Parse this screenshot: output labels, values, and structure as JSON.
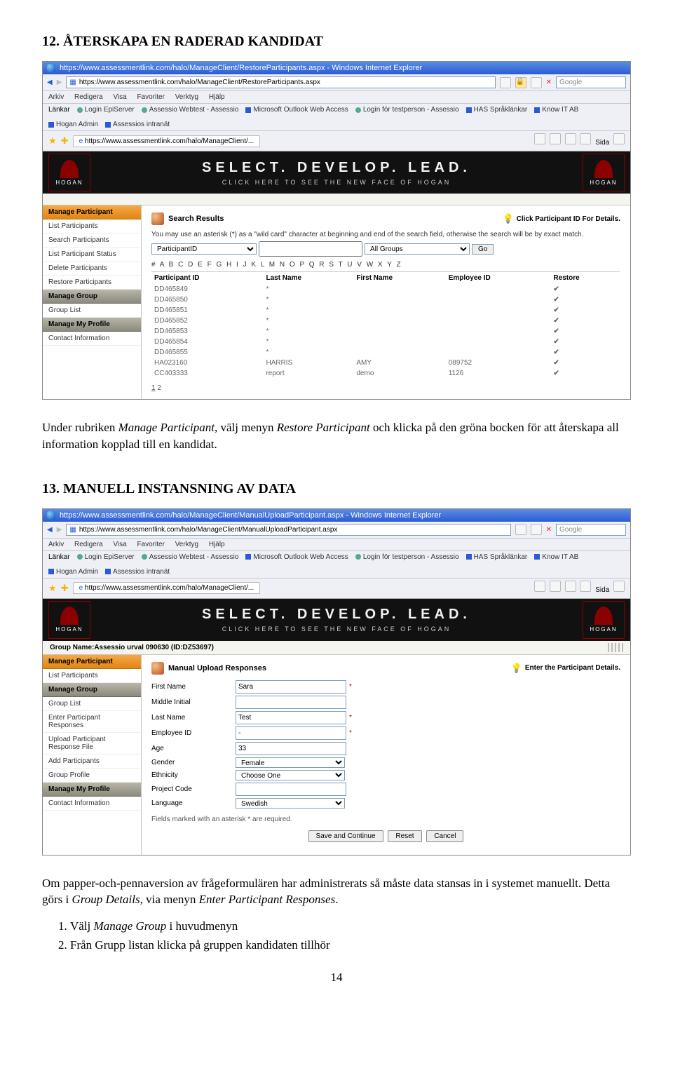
{
  "section12": {
    "heading": "12. ÅTERSKAPA EN RADERAD KANDIDAT",
    "para_pre": "Under rubriken ",
    "para_em1": "Manage Participant",
    "para_mid1": ", välj menyn ",
    "para_em2": "Restore Participant",
    "para_mid2": " och klicka på den gröna bocken för att återskapa all information kopplad till en kandidat."
  },
  "section13": {
    "heading": "13. MANUELL INSTANSNING AV DATA",
    "para_pre": "Om papper-och-pennaversion av frågeformulären har administrerats så måste data stansas in i systemet manuellt. Detta görs i ",
    "para_em1": "Group Details",
    "para_mid1": ", via menyn ",
    "para_em2": "Enter Participant Responses",
    "para_end": ".",
    "ol1_pre": "Välj ",
    "ol1_em": "Manage Group",
    "ol1_post": " i huvudmenyn",
    "ol2": "Från Grupp listan klicka på gruppen kandidaten tillhör"
  },
  "shot1": {
    "title": "https://www.assessmentlink.com/halo/ManageClient/RestoreParticipants.aspx - Windows Internet Explorer",
    "url": "https://www.assessmentlink.com/halo/ManageClient/RestoreParticipants.aspx",
    "search_ph": "Google",
    "menus": [
      "Arkiv",
      "Redigera",
      "Visa",
      "Favoriter",
      "Verktyg",
      "Hjälp"
    ],
    "links_label": "Länkar",
    "links": [
      "Login EpiServer",
      "Assessio Webtest - Assessio",
      "Microsoft Outlook Web Access",
      "Login för testperson - Assessio",
      "HAS Språklänkar",
      "Know IT AB",
      "Hogan Admin",
      "Assessios intranät"
    ],
    "tab": "https://www.assessmentlink.com/halo/ManageClient/...",
    "sida": "Sida",
    "banner_t": "SELECT. DEVELOP. LEAD.",
    "banner_s": "CLICK HERE TO SEE THE NEW FACE OF HOGAN",
    "logo": "HOGAN",
    "side_hd1": "Manage Participant",
    "side_items1": [
      "List Participants",
      "Search Participants",
      "List Participant Status",
      "Delete Participants",
      "Restore Participants"
    ],
    "side_hd2": "Manage Group",
    "side_items2": [
      "Group List"
    ],
    "side_hd3": "Manage My Profile",
    "side_items3": [
      "Contact Information"
    ],
    "c_title": "Search Results",
    "c_hint": "Click Participant ID For Details.",
    "c_note": "You may use an asterisk (*) as a \"wild card\" character at beginning and end of the search field, otherwise the search will be by exact match.",
    "sel1": "ParticipantID",
    "sel2": "All Groups",
    "go": "Go",
    "az": "# A B C D E F G H I J K L M N O P Q R S T U V W X Y Z",
    "cols": [
      "Participant ID",
      "Last Name",
      "First Name",
      "Employee ID",
      "Restore"
    ],
    "rows": [
      {
        "id": "DD465849",
        "ln": "*",
        "fn": "",
        "eid": ""
      },
      {
        "id": "DD465850",
        "ln": "*",
        "fn": "",
        "eid": ""
      },
      {
        "id": "DD465851",
        "ln": "*",
        "fn": "",
        "eid": ""
      },
      {
        "id": "DD465852",
        "ln": "*",
        "fn": "",
        "eid": ""
      },
      {
        "id": "DD465853",
        "ln": "*",
        "fn": "",
        "eid": ""
      },
      {
        "id": "DD465854",
        "ln": "*",
        "fn": "",
        "eid": ""
      },
      {
        "id": "DD465855",
        "ln": "*",
        "fn": "",
        "eid": ""
      },
      {
        "id": "HA023160",
        "ln": "HARRIS",
        "fn": "AMY",
        "eid": "089752"
      },
      {
        "id": "CC403333",
        "ln": "report",
        "fn": "demo",
        "eid": "1126"
      }
    ],
    "pages": [
      "1",
      "2"
    ]
  },
  "shot2": {
    "title": "https://www.assessmentlink.com/halo/ManageClient/ManualUploadParticipant.aspx - Windows Internet Explorer",
    "url": "https://www.assessmentlink.com/halo/ManageClient/ManualUploadParticipant.aspx",
    "search_ph": "Google",
    "menus": [
      "Arkiv",
      "Redigera",
      "Visa",
      "Favoriter",
      "Verktyg",
      "Hjälp"
    ],
    "links_label": "Länkar",
    "links": [
      "Login EpiServer",
      "Assessio Webtest - Assessio",
      "Microsoft Outlook Web Access",
      "Login för testperson - Assessio",
      "HAS Språklänkar",
      "Know IT AB",
      "Hogan Admin",
      "Assessios intranät"
    ],
    "tab": "https://www.assessmentlink.com/halo/ManageClient/...",
    "sida": "Sida",
    "banner_t": "SELECT. DEVELOP. LEAD.",
    "banner_s": "CLICK HERE TO SEE THE NEW FACE OF HOGAN",
    "logo": "HOGAN",
    "crumb": "Group Name:Assessio urval 090630 (ID:DZ53697)",
    "side_hd1": "Manage Participant",
    "side_items1": [
      "List Participants"
    ],
    "side_hd2": "Manage Group",
    "side_items2": [
      "Group List",
      "Enter Participant Responses",
      "Upload Participant Response File",
      "Add Participants",
      "Group Profile"
    ],
    "side_hd3": "Manage My Profile",
    "side_items3": [
      "Contact Information"
    ],
    "c_title": "Manual Upload Responses",
    "c_hint": "Enter the Participant Details.",
    "fields": [
      {
        "label": "First Name",
        "value": "Sara",
        "req": true,
        "type": "text"
      },
      {
        "label": "Middle Initial",
        "value": "",
        "req": false,
        "type": "text"
      },
      {
        "label": "Last Name",
        "value": "Test",
        "req": true,
        "type": "text"
      },
      {
        "label": "Employee ID",
        "value": "-",
        "req": true,
        "type": "text"
      },
      {
        "label": "Age",
        "value": "33",
        "req": false,
        "type": "text"
      },
      {
        "label": "Gender",
        "value": "Female",
        "req": false,
        "type": "select"
      },
      {
        "label": "Ethnicity",
        "value": "Choose One",
        "req": false,
        "type": "select"
      },
      {
        "label": "Project Code",
        "value": "",
        "req": false,
        "type": "text"
      },
      {
        "label": "Language",
        "value": "Swedish",
        "req": false,
        "type": "select"
      }
    ],
    "foot": "Fields marked with an asterisk * are required.",
    "btns": [
      "Save and Continue",
      "Reset",
      "Cancel"
    ]
  },
  "pagenum": "14"
}
